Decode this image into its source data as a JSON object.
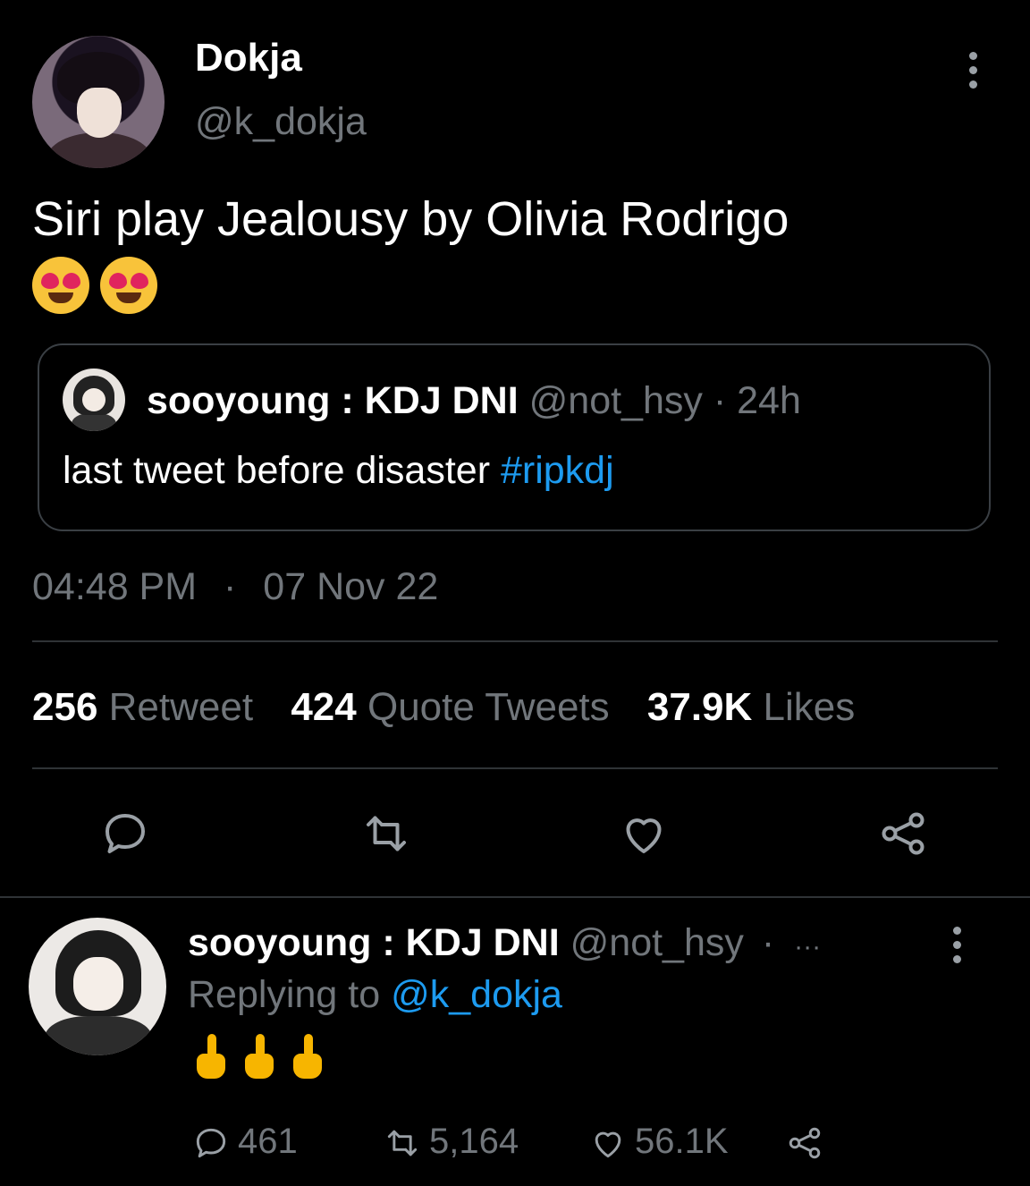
{
  "tweet": {
    "author_name": "Dokja",
    "author_handle": "@k_dokja",
    "text": "Siri play Jealousy by Olivia Rodrigo",
    "emoji_icon": "heart-eyes-emoji",
    "timestamp_time": "04:48 PM",
    "timestamp_sep": "·",
    "timestamp_date": "07 Nov 22"
  },
  "quote": {
    "author_name": "sooyoung : KDJ DNI",
    "author_handle": "@not_hsy",
    "sep": "·",
    "time": "24h",
    "text": "last tweet before disaster",
    "hashtag": "#ripkdj"
  },
  "stats": {
    "retweets_count": "256",
    "retweets_label": "Retweet",
    "quotes_count": "424",
    "quotes_label": "Quote Tweets",
    "likes_count": "37.9K",
    "likes_label": "Likes"
  },
  "reply": {
    "author_name": "sooyoung : KDJ DNI",
    "author_handle": "@not_hsy",
    "sep": "·",
    "ellipsis": "···",
    "replying_to_label": "Replying to",
    "replying_to_handle": "@k_dokja",
    "emoji_icon": "middle-finger-emoji",
    "replies": "461",
    "retweets": "5,164",
    "likes": "56.1K"
  },
  "colors": {
    "background": "#000000",
    "text": "#e7e9ea",
    "muted": "#71767b",
    "link": "#1d9bf0",
    "divider": "#2f3336"
  }
}
